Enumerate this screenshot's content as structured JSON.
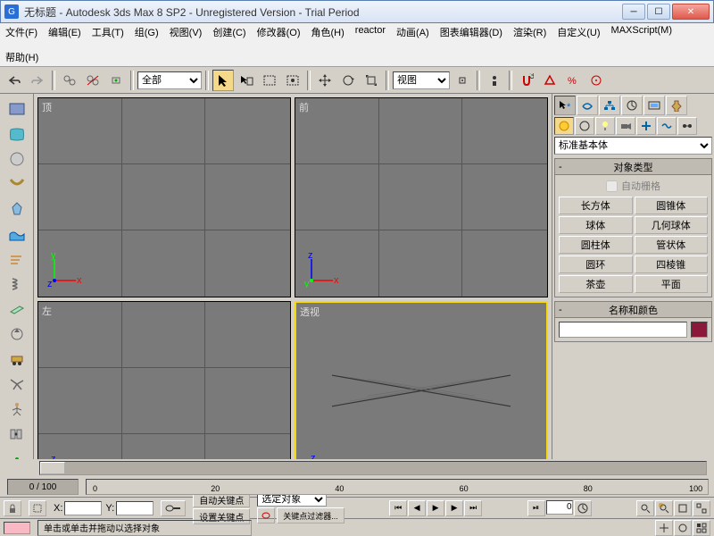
{
  "window": {
    "title": "无标题 - Autodesk 3ds Max 8 SP2  - Unregistered Version - Trial Period",
    "icon_letter": "G"
  },
  "menu": {
    "items": [
      "文件(F)",
      "编辑(E)",
      "工具(T)",
      "组(G)",
      "视图(V)",
      "创建(C)",
      "修改器(O)",
      "角色(H)",
      "reactor",
      "动画(A)",
      "图表编辑器(D)",
      "渲染(R)",
      "自定义(U)",
      "MAXScript(M)",
      "帮助(H)"
    ]
  },
  "toolbar": {
    "select_filter": "全部",
    "ref_sys": "视图"
  },
  "viewports": {
    "tl": "顶",
    "tr": "前",
    "bl": "左",
    "br": "透视"
  },
  "cmdpanel": {
    "category": "标准基本体",
    "rollout_type": "对象类型",
    "autogrid": "自动栅格",
    "buttons": [
      "长方体",
      "圆锥体",
      "球体",
      "几何球体",
      "圆柱体",
      "管状体",
      "圆环",
      "四棱锥",
      "茶壶",
      "平面"
    ],
    "rollout_name": "名称和颜色",
    "name_value": ""
  },
  "time": {
    "frame": "0",
    "range": "0 / 100",
    "ticks": [
      "0",
      "20",
      "40",
      "60",
      "80",
      "100"
    ]
  },
  "status": {
    "prompt": "单击或单击并拖动以选择对象",
    "x": "X:",
    "y": "Y:",
    "autokey": "自动关键点",
    "setkey": "设置关键点",
    "sel_label": "选定对象",
    "keyfilter": "关键点过滤器...",
    "curframe": "0"
  }
}
